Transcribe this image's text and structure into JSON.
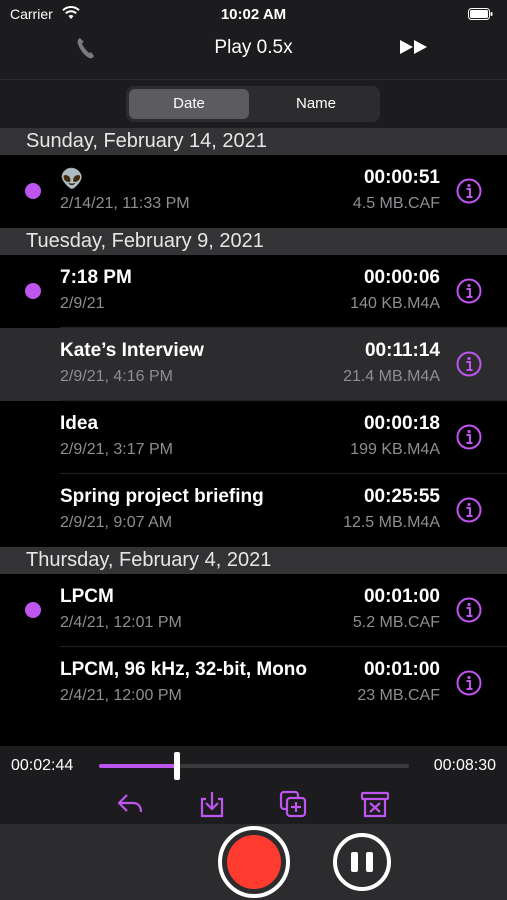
{
  "status": {
    "carrier": "Carrier",
    "time": "10:02 AM"
  },
  "nav": {
    "title": "Play 0.5x",
    "left_icon": "phone-icon",
    "right_icon": "fast-forward-icon"
  },
  "sort": {
    "options": [
      "Date",
      "Name"
    ],
    "selected": "Date"
  },
  "sections": [
    {
      "header": "Sunday, February 14, 2021",
      "rows": [
        {
          "name": "👽",
          "date": "2/14/21, 11:33 PM",
          "duration": "00:00:51",
          "size": "4.5 MB.CAF",
          "dot": true,
          "highlight": false
        }
      ]
    },
    {
      "header": "Tuesday, February 9, 2021",
      "rows": [
        {
          "name": "7:18 PM",
          "date": "2/9/21",
          "duration": "00:00:06",
          "size": "140 KB.M4A",
          "dot": true,
          "highlight": false
        },
        {
          "name": "Kate’s Interview",
          "date": "2/9/21, 4:16 PM",
          "duration": "00:11:14",
          "size": "21.4 MB.M4A",
          "dot": false,
          "highlight": true
        },
        {
          "name": "Idea",
          "date": "2/9/21, 3:17 PM",
          "duration": "00:00:18",
          "size": "199 KB.M4A",
          "dot": false,
          "highlight": false
        },
        {
          "name": "Spring project briefing",
          "date": "2/9/21, 9:07 AM",
          "duration": "00:25:55",
          "size": "12.5 MB.M4A",
          "dot": false,
          "highlight": false
        }
      ]
    },
    {
      "header": "Thursday, February 4, 2021",
      "rows": [
        {
          "name": "LPCM",
          "date": "2/4/21, 12:01 PM",
          "duration": "00:01:00",
          "size": "5.2 MB.CAF",
          "dot": true,
          "highlight": false
        },
        {
          "name": "LPCM, 96 kHz, 32-bit, Mono",
          "date": "2/4/21, 12:00 PM",
          "duration": "00:01:00",
          "size": "23 MB.CAF",
          "dot": false,
          "highlight": false
        }
      ]
    }
  ],
  "player": {
    "elapsed": "00:02:44",
    "total": "00:08:30",
    "progress": 0.25
  },
  "toolbar": [
    "reply-icon",
    "download-icon",
    "duplicate-icon",
    "trash-icon"
  ],
  "colors": {
    "accent": "#bd55ee",
    "record": "#ff3b30",
    "background": "#000000",
    "bar": "#1c1c1e"
  }
}
